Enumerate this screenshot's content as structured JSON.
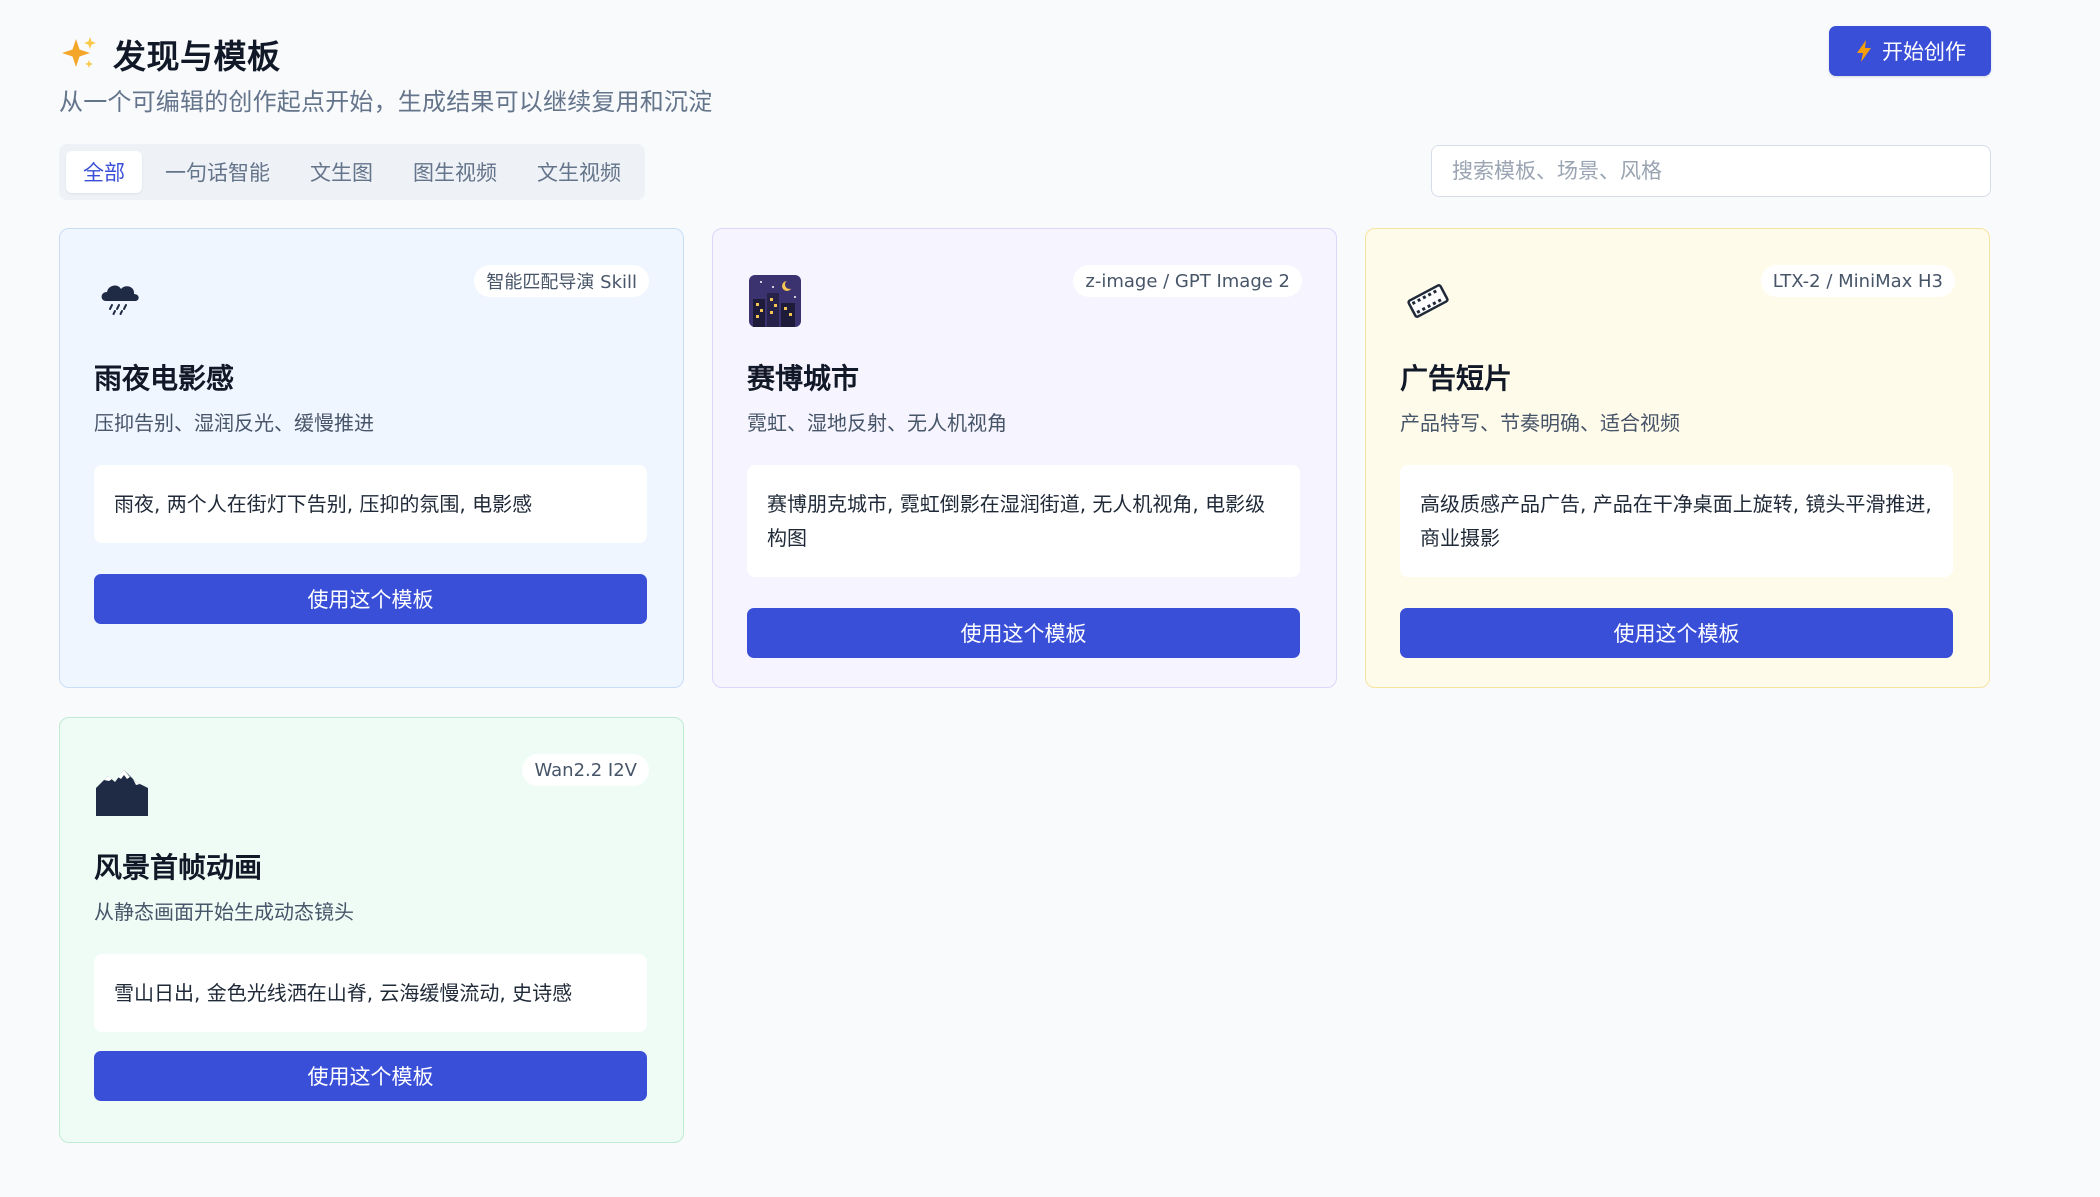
{
  "header": {
    "title": "发现与模板",
    "title_icon": "sparkles-icon",
    "subtitle": "从一个可编辑的创作起点开始，生成结果可以继续复用和沉淀",
    "cta_label": "开始创作",
    "cta_icon": "lightning-icon"
  },
  "tabs": [
    {
      "label": "全部",
      "active": true
    },
    {
      "label": "一句话智能",
      "active": false
    },
    {
      "label": "文生图",
      "active": false
    },
    {
      "label": "图生视频",
      "active": false
    },
    {
      "label": "文生视频",
      "active": false
    }
  ],
  "search": {
    "placeholder": "搜索模板、场景、风格",
    "value": ""
  },
  "colors": {
    "primary": "#3a4fd8",
    "card_blue": "#f0f6ff",
    "card_purple": "#f6f4fe",
    "card_yellow": "#fffbeb",
    "card_green": "#effcf5"
  },
  "templates": [
    {
      "icon": "rain-cloud-icon",
      "badge": "智能匹配导演 Skill",
      "title": "雨夜电影感",
      "description": "压抑告别、湿润反光、缓慢推进",
      "prompt": "雨夜, 两个人在街灯下告别, 压抑的氛围, 电影感",
      "button_label": "使用这个模板"
    },
    {
      "icon": "night-city-icon",
      "badge": "z-image / GPT Image 2",
      "title": "赛博城市",
      "description": "霓虹、湿地反射、无人机视角",
      "prompt": "赛博朋克城市, 霓虹倒影在湿润街道, 无人机视角, 电影级构图",
      "button_label": "使用这个模板"
    },
    {
      "icon": "film-strip-icon",
      "badge": "LTX-2 / MiniMax H3",
      "title": "广告短片",
      "description": "产品特写、节奏明确、适合视频",
      "prompt": "高级质感产品广告, 产品在干净桌面上旋转, 镜头平滑推进, 商业摄影",
      "button_label": "使用这个模板"
    },
    {
      "icon": "snow-mountain-icon",
      "badge": "Wan2.2 I2V",
      "title": "风景首帧动画",
      "description": "从静态画面开始生成动态镜头",
      "prompt": "雪山日出, 金色光线洒在山脊, 云海缓慢流动, 史诗感",
      "button_label": "使用这个模板"
    }
  ]
}
